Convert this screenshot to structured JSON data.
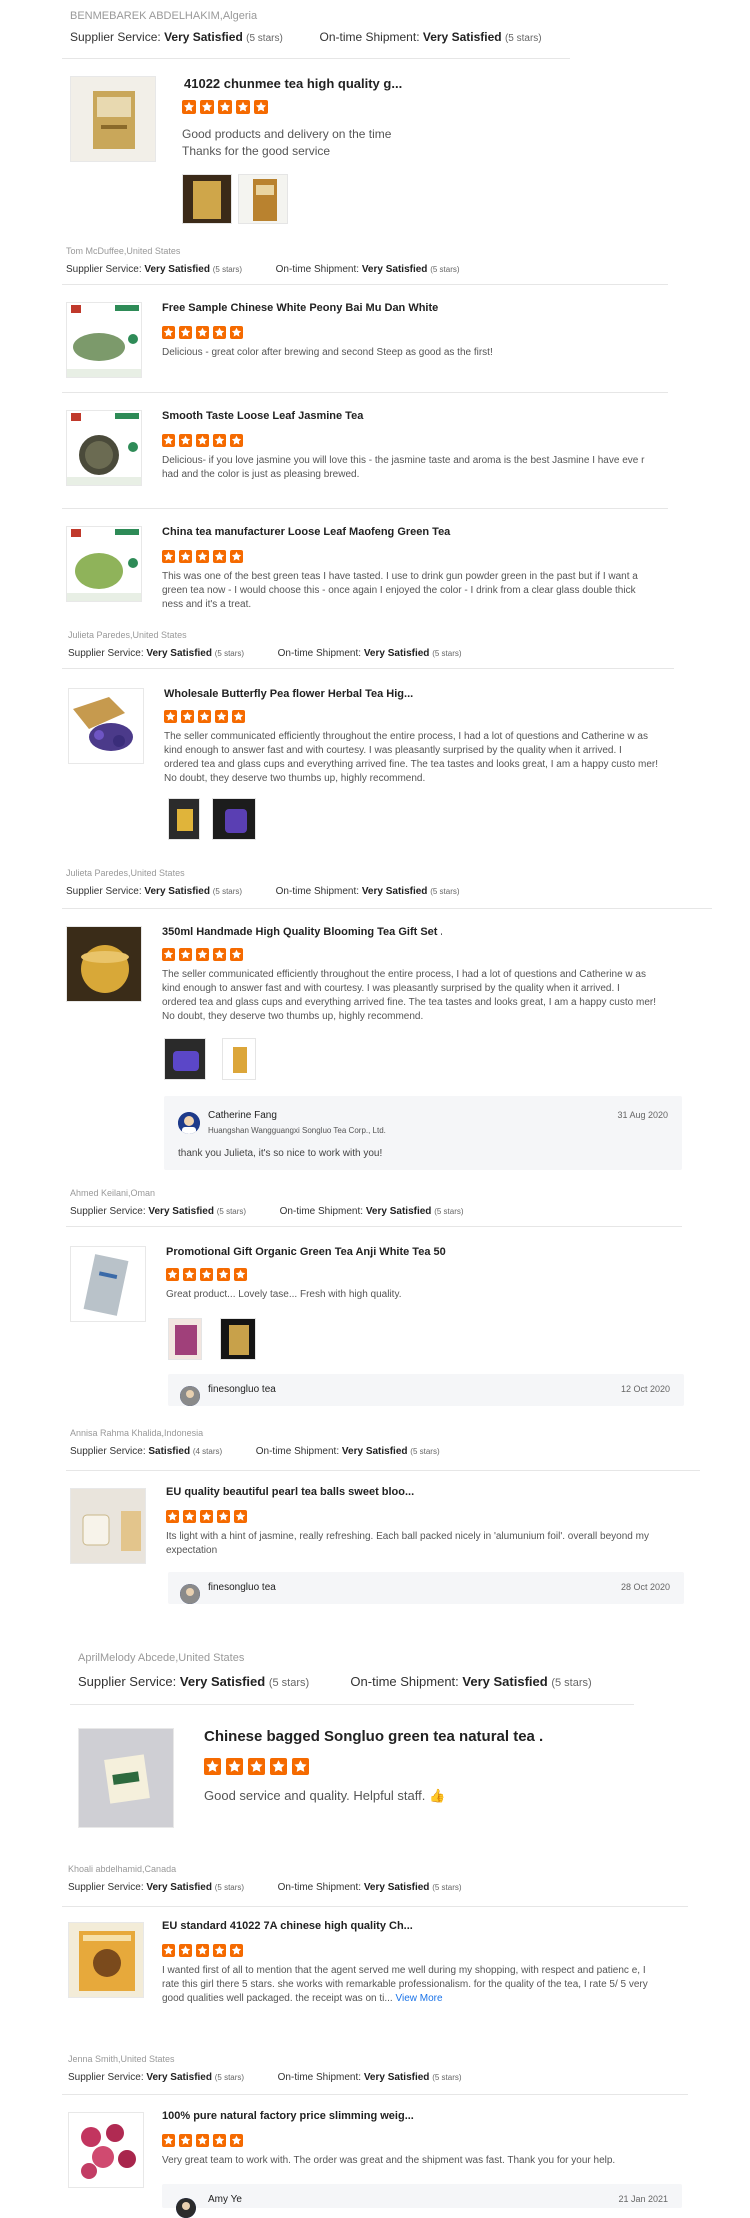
{
  "labels": {
    "supplier_service": "Supplier Service:",
    "ontime_shipment": "On-time Shipment:"
  },
  "reviews": [
    {
      "reviewer": "BENMEBAREK ABDELHAKIM,Algeria",
      "supplier_rating": "Very Satisfied",
      "supplier_count": "(5 stars)",
      "shipment_rating": "Very Satisfied",
      "shipment_count": "(5 stars)",
      "products": [
        {
          "title": "41022 chunmee tea high quality g...",
          "stars": 5,
          "text": "Good products and delivery on the time\nThanks for the good service"
        }
      ]
    },
    {
      "reviewer": "Tom McDuffee,United States",
      "supplier_rating": "Very Satisfied",
      "supplier_count": "(5 stars)",
      "shipment_rating": "Very Satisfied",
      "shipment_count": "(5 stars)",
      "products": [
        {
          "title": "Free Sample Chinese White Peony Bai Mu Dan White ...",
          "stars": 5,
          "text": "Delicious - great color after brewing and second Steep as good as the first!"
        },
        {
          "title": "Smooth Taste Loose Leaf Jasmine Tea",
          "stars": 5,
          "text": "Delicious- if you love jasmine you will love this - the jasmine taste and aroma is the best Jasmine I have eve r had and the color is just as pleasing brewed."
        },
        {
          "title": "China tea manufacturer Loose Leaf Maofeng Green Tea",
          "stars": 5,
          "text": "This was one of the best green teas I have tasted. I use to drink gun powder green in the past but if I want a green tea now - I would choose this - once again I enjoyed the color - I drink from a clear glass double thick ness and it's a treat."
        }
      ]
    },
    {
      "reviewer": "Julieta Paredes,United States",
      "supplier_rating": "Very Satisfied",
      "supplier_count": "(5 stars)",
      "shipment_rating": "Very Satisfied",
      "shipment_count": "(5 stars)",
      "products": [
        {
          "title": "Wholesale Butterfly Pea flower Herbal Tea Hig...",
          "stars": 5,
          "text": "The seller communicated efficiently throughout the entire process, I had a lot of questions and Catherine w as kind enough to answer fast and with courtesy. I was pleasantly surprised by the quality when it arrived. I ordered tea and glass cups and everything arrived fine. The tea tastes and looks great, I am a happy custo mer! No doubt, they deserve two thumbs up, highly recommend."
        }
      ]
    },
    {
      "reviewer": "Julieta Paredes,United States",
      "supplier_rating": "Very Satisfied",
      "supplier_count": "(5 stars)",
      "shipment_rating": "Very Satisfied",
      "shipment_count": "(5 stars)",
      "products": [
        {
          "title": "350ml Handmade High Quality Blooming Tea Gift Set ...",
          "stars": 5,
          "text": "The seller communicated efficiently throughout the entire process, I had a lot of questions and Catherine w as kind enough to answer fast and with courtesy. I was pleasantly surprised by the quality when it arrived. I ordered tea and glass cups and everything arrived fine. The tea tastes and looks great, I am a happy custo mer! No doubt, they deserve two thumbs up, highly recommend."
        }
      ],
      "reply": {
        "name": "Catherine Fang",
        "company": "Huangshan Wangguangxi Songluo Tea Corp., Ltd.",
        "date": "31 Aug 2020",
        "text": "thank you Julieta, it's so nice to work with you!"
      }
    },
    {
      "reviewer": "Ahmed Keilani,Oman",
      "supplier_rating": "Very Satisfied",
      "supplier_count": "(5 stars)",
      "shipment_rating": "Very Satisfied",
      "shipment_count": "(5 stars)",
      "products": [
        {
          "title": "Promotional Gift Organic Green Tea Anji White Tea 50...",
          "stars": 5,
          "text": "Great product... Lovely tase... Fresh with high quality."
        }
      ],
      "reply": {
        "name": "finesongluo tea",
        "date": "12 Oct 2020"
      }
    },
    {
      "reviewer": "Annisa Rahma Khalida,Indonesia",
      "supplier_rating": "Satisfied",
      "supplier_count": "(4 stars)",
      "shipment_rating": "Very Satisfied",
      "shipment_count": "(5 stars)",
      "products": [
        {
          "title": "EU quality beautiful pearl tea balls sweet bloo...",
          "stars": 5,
          "text": "Its light with a hint of jasmine, really refreshing. Each ball packed nicely in 'alumunium foil'. overall beyond my expectation"
        }
      ],
      "reply": {
        "name": "finesongluo tea",
        "date": "28 Oct 2020"
      }
    },
    {
      "reviewer": "AprilMelody Abcede,United States",
      "supplier_rating": "Very Satisfied",
      "supplier_count": "(5 stars)",
      "shipment_rating": "Very Satisfied",
      "shipment_count": "(5 stars)",
      "products": [
        {
          "title": "Chinese bagged Songluo green tea natural tea ...",
          "stars": 5,
          "text": "Good service and quality. Helpful staff. 👍"
        }
      ]
    },
    {
      "reviewer": "Khoali abdelhamid,Canada",
      "supplier_rating": "Very Satisfied",
      "supplier_count": "(5 stars)",
      "shipment_rating": "Very Satisfied",
      "shipment_count": "(5 stars)",
      "products": [
        {
          "title": "EU standard 41022 7A chinese high quality Ch...",
          "stars": 5,
          "text": "I wanted first of all to mention that the agent served me well during my shopping, with respect and patienc e, I rate this girl there 5 stars. she works with remarkable professionalism. for the quality of the tea, I rate 5/ 5 very good qualities well packaged. the receipt was on ti...",
          "more": "View More"
        }
      ]
    },
    {
      "reviewer": "Jenna Smith,United States",
      "supplier_rating": "Very Satisfied",
      "supplier_count": "(5 stars)",
      "shipment_rating": "Very Satisfied",
      "shipment_count": "(5 stars)",
      "products": [
        {
          "title": "100% pure natural factory price slimming weig...",
          "stars": 5,
          "text": "Very great team to work with. The order was great and the shipment was fast. Thank you for your help."
        }
      ],
      "reply": {
        "name": "Amy Ye",
        "date": "21 Jan 2021"
      }
    }
  ],
  "colors": {
    "star": "#f56a00",
    "link": "#1a73e8",
    "reply_bg": "#f5f6f8"
  }
}
